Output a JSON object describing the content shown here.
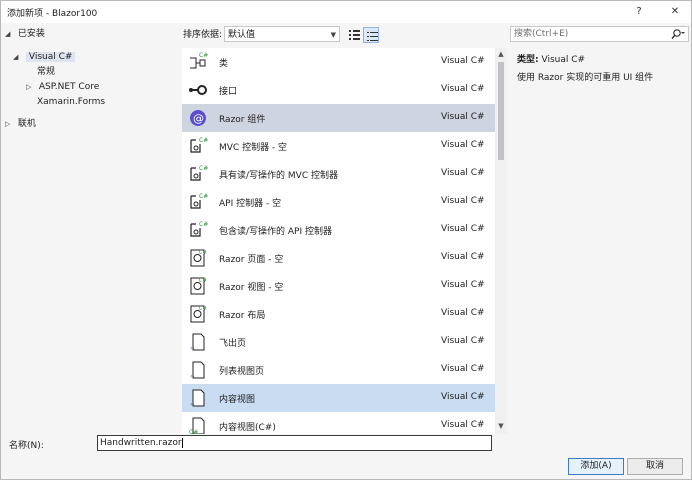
{
  "window": {
    "title": "添加新项 - Blazor100",
    "help_label": "?",
    "close_label": "✕"
  },
  "left_tree": {
    "installed_label": "已安装",
    "items": [
      {
        "label": "Visual C#"
      },
      {
        "label": "常规"
      },
      {
        "label": "ASP.NET Core"
      },
      {
        "label": "Xamarin.Forms"
      }
    ],
    "online_label": "联机"
  },
  "toolbar": {
    "sort_label": "排序依据:",
    "sort_value": "默认值",
    "search_placeholder": "搜索(Ctrl+E)"
  },
  "templates": [
    {
      "name": "类",
      "language": "Visual C#",
      "icon": "class-icon"
    },
    {
      "name": "接口",
      "language": "Visual C#",
      "icon": "interface-icon"
    },
    {
      "name": "Razor 组件",
      "language": "Visual C#",
      "icon": "razor-component-icon"
    },
    {
      "name": "MVC 控制器 - 空",
      "language": "Visual C#",
      "icon": "controller-icon"
    },
    {
      "name": "具有读/写操作的 MVC 控制器",
      "language": "Visual C#",
      "icon": "controller-icon"
    },
    {
      "name": "API 控制器 - 空",
      "language": "Visual C#",
      "icon": "controller-icon"
    },
    {
      "name": "包含读/写操作的 API 控制器",
      "language": "Visual C#",
      "icon": "controller-icon"
    },
    {
      "name": "Razor 页面 - 空",
      "language": "Visual C#",
      "icon": "razor-page-icon"
    },
    {
      "name": "Razor 视图 - 空",
      "language": "Visual C#",
      "icon": "razor-page-icon"
    },
    {
      "name": "Razor 布局",
      "language": "Visual C#",
      "icon": "razor-page-icon"
    },
    {
      "name": "飞出页",
      "language": "Visual C#",
      "icon": "xaml-page-icon"
    },
    {
      "name": "列表视图页",
      "language": "Visual C#",
      "icon": "xaml-page-icon"
    },
    {
      "name": "内容视图",
      "language": "Visual C#",
      "icon": "xaml-page-icon"
    },
    {
      "name": "内容视图(C#)",
      "language": "Visual C#",
      "icon": "cs-page-icon"
    }
  ],
  "info": {
    "type_label": "类型:",
    "type_value": "Visual C#",
    "description": "使用 Razor 实现的可重用 UI 组件"
  },
  "name_field": {
    "label": "名称(N):",
    "value": "Handwritten.razor"
  },
  "buttons": {
    "add": "添加(A)",
    "cancel": "取消"
  },
  "colors": {
    "hover_row": "#cfd4e1",
    "selected_row": "#c9dcf2",
    "accent": "#3e78c8"
  }
}
